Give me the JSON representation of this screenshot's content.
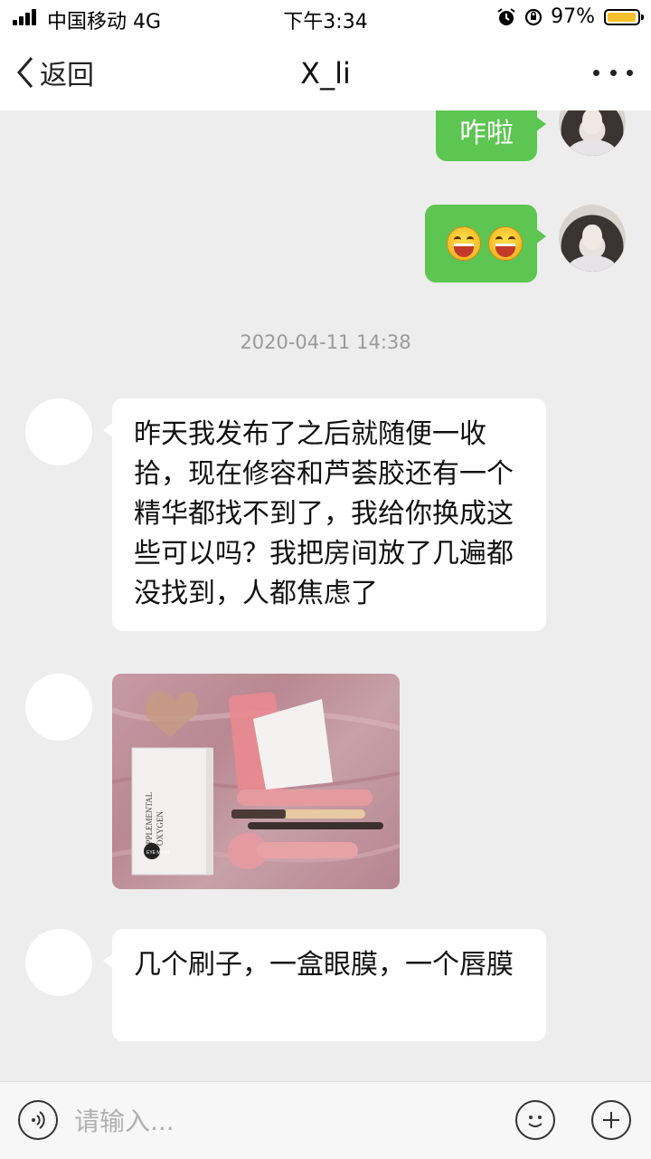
{
  "status_bar": {
    "carrier": "中国移动 4G",
    "time": "下午3:34",
    "battery_percent": "97%",
    "battery_level": 0.97
  },
  "nav": {
    "back_label": "返回",
    "title": "X_li"
  },
  "messages": {
    "sent_1": "咋啦",
    "timestamp": "2020-04-11 14:38",
    "received_1": "昨天我发布了之后就随便一收拾，现在修容和芦荟胶还有一个精华都找不到了，我给你换成这些可以吗？我把房间放了几遍都没找到，人都焦虑了",
    "received_2": "几个刷子，一盒眼膜，一个唇膜"
  },
  "photo": {
    "box_label_1": "SUPPLEMENTAL",
    "box_label_2": "OXYGEN",
    "box_brand": "EYE MASK"
  },
  "input": {
    "placeholder": "请输入..."
  },
  "colors": {
    "sent_bubble": "#5dc552",
    "chat_background": "#ededed"
  }
}
